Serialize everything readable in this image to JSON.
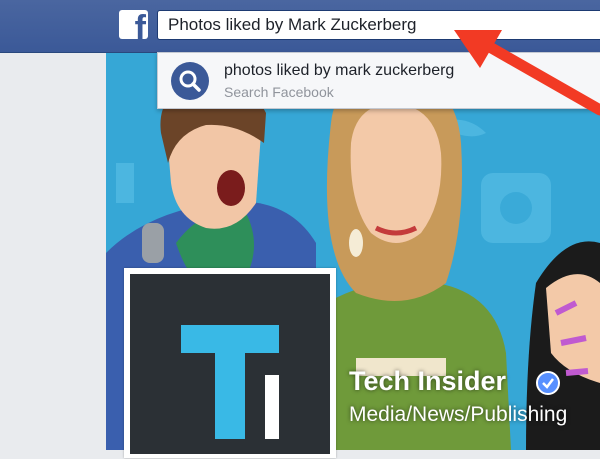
{
  "header": {
    "logo_letter": "f",
    "search": {
      "value": "Photos liked by Mark Zuckerberg"
    }
  },
  "search_suggestion": {
    "title": "photos liked by mark zuckerberg",
    "subtitle": "Search Facebook",
    "icon": "search-icon"
  },
  "page": {
    "name": "Tech Insider",
    "category": "Media/News/Publishing",
    "verified_icon": "verified-check-icon",
    "profile_logo_letters": "TI"
  },
  "colors": {
    "brand_blue": "#3b5998",
    "cover_blue": "#36a7d6",
    "annotation_red": "#f23a24",
    "logo_cyan": "#39b9e6",
    "verified_blue": "#5890ff"
  }
}
